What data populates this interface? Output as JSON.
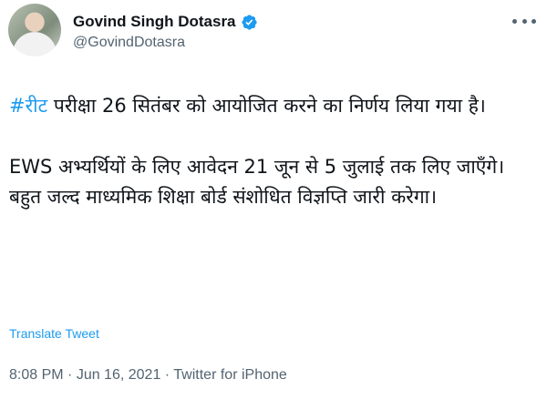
{
  "author": {
    "display_name": "Govind Singh Dotasra",
    "handle": "@GovindDotasra",
    "verified": true
  },
  "tweet": {
    "hashtag": "#रीट",
    "paragraph_1_rest": " परीक्षा 26 सितंबर को आयोजित करने का निर्णय लिया गया है।",
    "paragraph_2": "EWS अभ्यर्थियों के लिए आवेदन 21 जून से 5 जुलाई तक लिए जाएँगे। बहुत जल्द माध्यमिक शिक्षा बोर्ड संशोधित विज्ञप्ति जारी करेगा।"
  },
  "translate_label": "Translate Tweet",
  "meta": {
    "time": "8:08 PM",
    "separator": " · ",
    "date": "Jun 16, 2021",
    "source": "Twitter for iPhone"
  },
  "colors": {
    "link": "#1d9bf0",
    "text": "#0f1419",
    "secondary": "#536471"
  },
  "icons": {
    "verified": "verified-badge-icon",
    "more": "more-options-icon"
  }
}
